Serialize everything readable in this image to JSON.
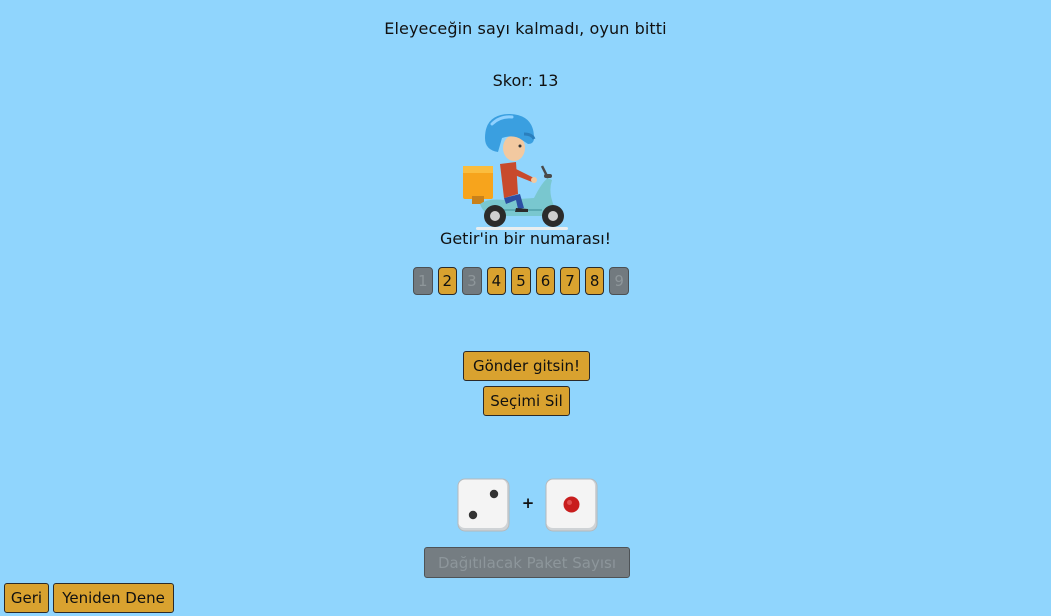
{
  "status_message": "Eleyeceğin sayı kalmadı, oyun bitti",
  "score_text": "Skor: 13",
  "tagline": "Getir'in bir numarası!",
  "tiles": [
    "1",
    "2",
    "3",
    "4",
    "5",
    "6",
    "7",
    "8",
    "9"
  ],
  "tile_enabled": [
    false,
    true,
    false,
    true,
    true,
    true,
    true,
    true,
    false
  ],
  "buttons": {
    "send": "Gönder gitsin!",
    "clear_selection": "Seçimi Sil",
    "distribute_packages": "Dağıtılacak Paket Sayısı",
    "back": "Geri",
    "retry": "Yeniden Dene"
  },
  "dice": {
    "values": [
      2,
      1
    ],
    "operator": "+"
  },
  "colors": {
    "background": "#90d5fd",
    "button_active": "#d9a22f",
    "button_disabled": "#757d82",
    "die_pip_black": "#333333",
    "die_pip_red": "#c81e1e"
  }
}
